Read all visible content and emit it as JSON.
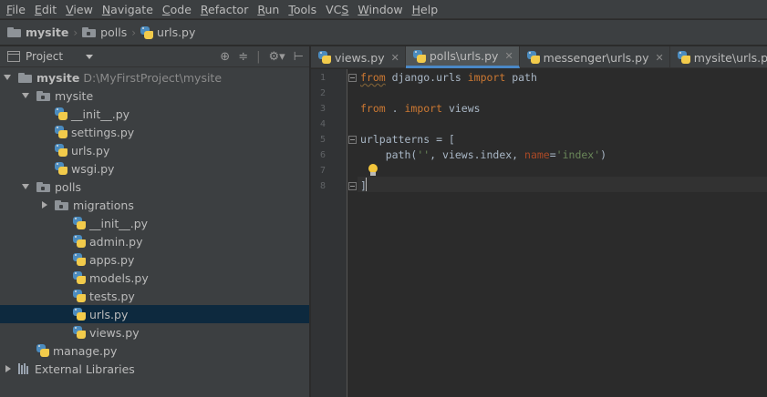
{
  "menu": [
    "File",
    "Edit",
    "View",
    "Navigate",
    "Code",
    "Refactor",
    "Run",
    "Tools",
    "VCS",
    "Window",
    "Help"
  ],
  "menu_mnemonics": [
    "F",
    "E",
    "V",
    "N",
    "C",
    "R",
    "R",
    "T",
    "S",
    "W",
    "H"
  ],
  "breadcrumb": [
    "mysite",
    "polls",
    "urls.py"
  ],
  "project_panel": {
    "title": "Project",
    "tools": [
      "target-icon",
      "collapse-icon",
      "gear-icon",
      "hide-icon"
    ],
    "tree": [
      {
        "label": "mysite",
        "path": "D:\\MyFirstProject\\mysite",
        "type": "folder",
        "expanded": true,
        "bold": true
      },
      {
        "label": "mysite",
        "type": "package",
        "expanded": true
      },
      {
        "label": "__init__.py",
        "type": "py"
      },
      {
        "label": "settings.py",
        "type": "py"
      },
      {
        "label": "urls.py",
        "type": "py"
      },
      {
        "label": "wsgi.py",
        "type": "py"
      },
      {
        "label": "polls",
        "type": "package",
        "expanded": true
      },
      {
        "label": "migrations",
        "type": "package",
        "expanded": false
      },
      {
        "label": "__init__.py",
        "type": "py"
      },
      {
        "label": "admin.py",
        "type": "py"
      },
      {
        "label": "apps.py",
        "type": "py"
      },
      {
        "label": "models.py",
        "type": "py"
      },
      {
        "label": "tests.py",
        "type": "py"
      },
      {
        "label": "urls.py",
        "type": "py",
        "selected": true
      },
      {
        "label": "views.py",
        "type": "py"
      },
      {
        "label": "manage.py",
        "type": "py"
      },
      {
        "label": "External Libraries",
        "type": "library",
        "expanded": false
      }
    ]
  },
  "tabs": [
    {
      "label": "views.py",
      "active": false
    },
    {
      "label": "polls\\urls.py",
      "active": true
    },
    {
      "label": "messenger\\urls.py",
      "active": false
    },
    {
      "label": "mysite\\urls.py",
      "active": false
    }
  ],
  "editor": {
    "line_numbers": [
      "1",
      "2",
      "3",
      "4",
      "5",
      "6",
      "7",
      "8"
    ],
    "lines": {
      "l1": {
        "from": "from",
        "mod": " django.urls ",
        "imp": "import",
        "name": " path"
      },
      "l3": {
        "from": "from",
        "mod": " . ",
        "imp": "import",
        "name": " views"
      },
      "l5": {
        "text": "urlpatterns = ["
      },
      "l6": {
        "a": "    path(",
        "s1": "''",
        "b": ", views.index, ",
        "p": "name",
        "c": "=",
        "s2": "'index'",
        "d": ")"
      },
      "l8": {
        "text": "]"
      }
    }
  },
  "colors": {
    "keyword": "#cc7832",
    "string": "#6a8759",
    "param": "#aa4926",
    "text": "#a9b7c6",
    "selection": "#0d293e",
    "tab_underline": "#4a88c7"
  }
}
